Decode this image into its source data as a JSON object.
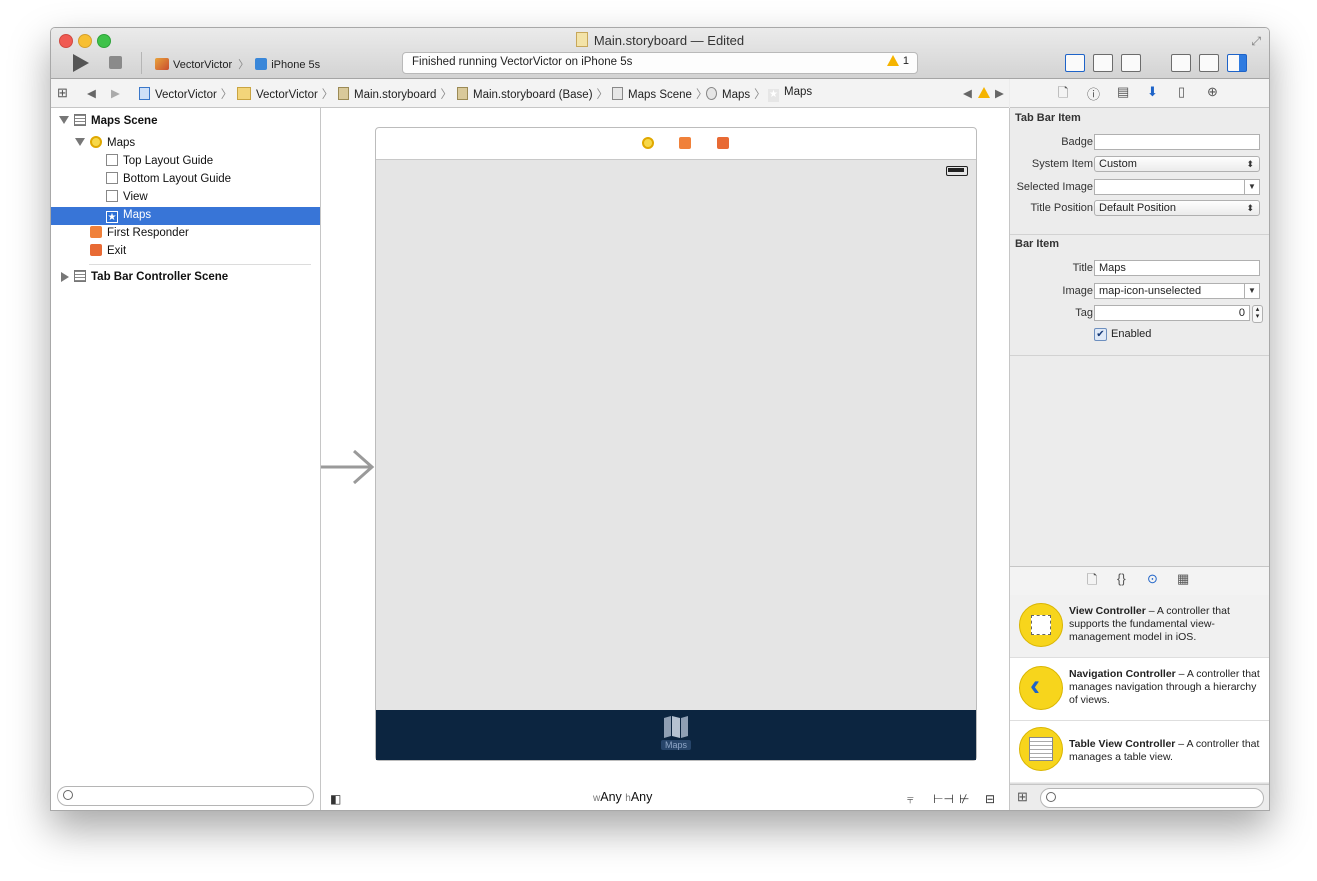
{
  "window": {
    "title": "Main.storyboard — Edited"
  },
  "toolbar": {
    "scheme_target": "VectorVictor",
    "scheme_device": "iPhone 5s",
    "status_text": "Finished running VectorVictor on iPhone 5s",
    "warning_count": "1"
  },
  "jumpbar": {
    "items": [
      "VectorVictor",
      "VectorVictor",
      "Main.storyboard",
      "Main.storyboard (Base)",
      "Maps Scene",
      "Maps",
      "Maps"
    ]
  },
  "navigator": {
    "scene1": "Maps Scene",
    "vc": "Maps",
    "top_guide": "Top Layout Guide",
    "bottom_guide": "Bottom Layout Guide",
    "view": "View",
    "tab_item": "Maps",
    "first_responder": "First Responder",
    "exit": "Exit",
    "scene2": "Tab Bar Controller Scene"
  },
  "canvas": {
    "tab_label": "Maps",
    "size_w_prefix": "w",
    "size_w": "Any",
    "size_h_prefix": "h",
    "size_h": "Any"
  },
  "inspector": {
    "tab_bar_item_title": "Tab Bar Item",
    "badge_label": "Badge",
    "badge_value": "",
    "system_item_label": "System Item",
    "system_item_value": "Custom",
    "selected_image_label": "Selected Image",
    "selected_image_value": "",
    "title_position_label": "Title Position",
    "title_position_value": "Default Position",
    "bar_item_title": "Bar Item",
    "title_label": "Title",
    "title_value": "Maps",
    "image_label": "Image",
    "image_value": "map-icon-unselected",
    "tag_label": "Tag",
    "tag_value": "0",
    "enabled_label": "Enabled"
  },
  "library": {
    "items": [
      {
        "name": "View Controller",
        "desc": " – A controller that supports the fundamental view-management model in iOS."
      },
      {
        "name": "Navigation Controller",
        "desc": " – A controller that manages navigation through a hierarchy of views."
      },
      {
        "name": "Table View Controller",
        "desc": " – A controller that manages a table view."
      }
    ]
  },
  "colors": {
    "selection": "#3875d7",
    "tabbar": "#0c2540",
    "accent": "#1e63c8",
    "warning": "#f5b400",
    "library_icon": "#f7d51c"
  }
}
